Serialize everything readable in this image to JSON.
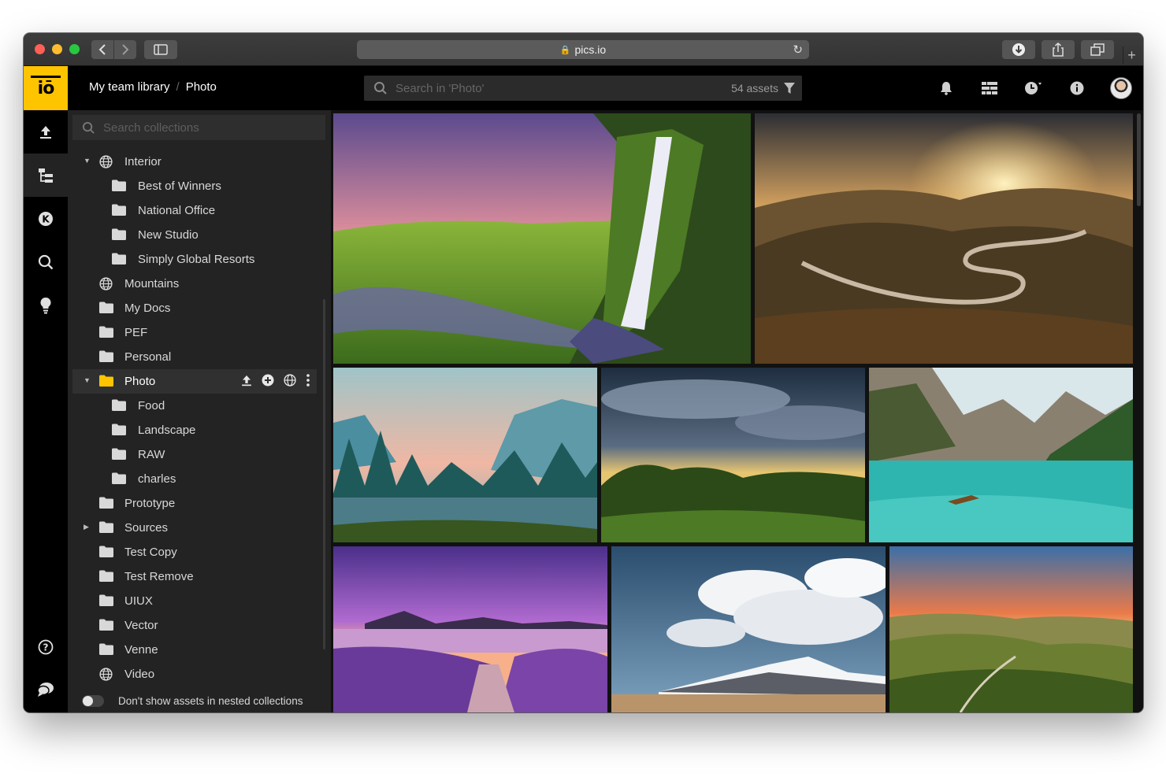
{
  "browser": {
    "url": "pics.io"
  },
  "header": {
    "breadcrumb": [
      "My team library",
      "/",
      "Photo"
    ],
    "search_placeholder": "Search in 'Photo'",
    "assets_count": "54 assets"
  },
  "collections": {
    "search_placeholder": "Search collections",
    "items": [
      {
        "label": "Interior",
        "icon": "globe-icon",
        "caret": "▼"
      },
      {
        "label": "Best of  Winners",
        "icon": "folder-icon"
      },
      {
        "label": "National Office",
        "icon": "folder-icon"
      },
      {
        "label": "New Studio",
        "icon": "folder-icon"
      },
      {
        "label": "Simply Global Resorts",
        "icon": "folder-icon"
      },
      {
        "label": "Mountains",
        "icon": "globe-icon"
      },
      {
        "label": "My Docs",
        "icon": "folder-icon"
      },
      {
        "label": "PEF",
        "icon": "folder-icon"
      },
      {
        "label": "Personal",
        "icon": "folder-icon"
      },
      {
        "label": "Photo",
        "icon": "folder-icon",
        "caret": "▼",
        "selected": true
      },
      {
        "label": "Food",
        "icon": "folder-icon"
      },
      {
        "label": "Landscape",
        "icon": "folder-icon"
      },
      {
        "label": "RAW",
        "icon": "folder-icon"
      },
      {
        "label": "charles",
        "icon": "folder-icon"
      },
      {
        "label": "Prototype",
        "icon": "folder-icon"
      },
      {
        "label": "Sources",
        "icon": "folder-icon",
        "caret": "▶"
      },
      {
        "label": "Test Copy",
        "icon": "folder-icon"
      },
      {
        "label": "Test Remove",
        "icon": "folder-icon"
      },
      {
        "label": "UIUX",
        "icon": "folder-icon"
      },
      {
        "label": "Vector",
        "icon": "folder-icon"
      },
      {
        "label": "Venne",
        "icon": "folder-icon"
      },
      {
        "label": "Video",
        "icon": "globe-icon"
      }
    ],
    "nested_toggle_label": "Don't show assets in nested collections",
    "nested_toggle_on": false
  },
  "rail": [
    "upload-icon",
    "collections-tree-icon",
    "keywords-icon",
    "search-icon",
    "lightbulb-icon",
    "help-icon",
    "chat-icon"
  ],
  "photos": [
    {
      "subject": "waterfall"
    },
    {
      "subject": "winding road at sunset"
    },
    {
      "subject": "misty valley river"
    },
    {
      "subject": "sun rays over forest"
    },
    {
      "subject": "turquoise mountain lake with boat"
    },
    {
      "subject": "purple lavender lake sunset"
    },
    {
      "subject": "clouds over snowy volcano"
    },
    {
      "subject": "rolling hills at sunset"
    }
  ],
  "colors": {
    "brand": "#ffc400",
    "folder_selected": "#ffc400",
    "background": "#232323"
  }
}
